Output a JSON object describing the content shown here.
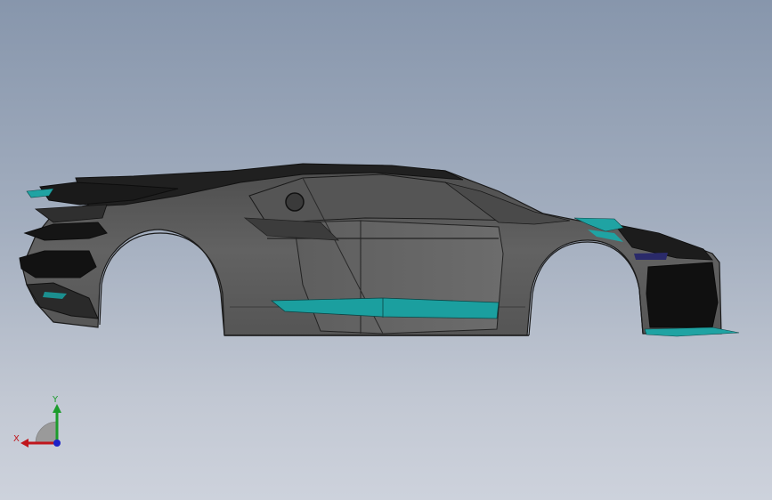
{
  "viewport": {
    "background_top": "#8796ac",
    "background_bottom": "#cdd2dc"
  },
  "model": {
    "body_color": "#5b5b5b",
    "accent_color": "#1fa3a3",
    "dark_color": "#141414"
  },
  "triad": {
    "x_label": "X",
    "y_label": "Y",
    "x_color": "#c0161c",
    "y_color": "#1c9c2c",
    "z_color": "#1c22c8"
  }
}
